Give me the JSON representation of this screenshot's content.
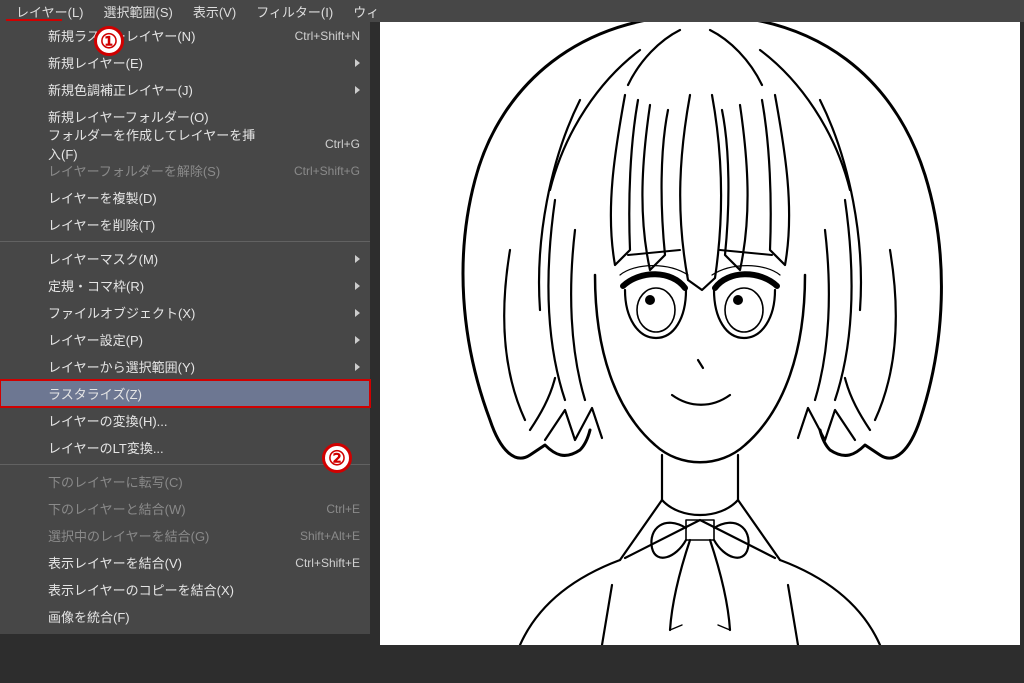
{
  "menubar": {
    "items": [
      {
        "label": "レイヤー(L)",
        "active": true
      },
      {
        "label": "選択範囲(S)"
      },
      {
        "label": "表示(V)"
      },
      {
        "label": "フィルター(I)"
      },
      {
        "label": "ウィ"
      }
    ]
  },
  "dropdown": {
    "items": [
      {
        "label": "新規ラスターレイヤー(N)",
        "shortcut": "Ctrl+Shift+N"
      },
      {
        "label": "新規レイヤー(E)",
        "submenu": true
      },
      {
        "label": "新規色調補正レイヤー(J)",
        "submenu": true
      },
      {
        "label": "新規レイヤーフォルダー(O)"
      },
      {
        "label": "フォルダーを作成してレイヤーを挿入(F)",
        "shortcut": "Ctrl+G"
      },
      {
        "label": "レイヤーフォルダーを解除(S)",
        "shortcut": "Ctrl+Shift+G",
        "disabled": true
      },
      {
        "label": "レイヤーを複製(D)"
      },
      {
        "label": "レイヤーを削除(T)"
      },
      {
        "sep": true
      },
      {
        "label": "レイヤーマスク(M)",
        "submenu": true
      },
      {
        "label": "定規・コマ枠(R)",
        "submenu": true
      },
      {
        "label": "ファイルオブジェクト(X)",
        "submenu": true
      },
      {
        "label": "レイヤー設定(P)",
        "submenu": true
      },
      {
        "label": "レイヤーから選択範囲(Y)",
        "submenu": true
      },
      {
        "label": "ラスタライズ(Z)",
        "highlight": true
      },
      {
        "label": "レイヤーの変換(H)..."
      },
      {
        "label": "レイヤーのLT変換..."
      },
      {
        "sep": true
      },
      {
        "label": "下のレイヤーに転写(C)",
        "disabled": true
      },
      {
        "label": "下のレイヤーと結合(W)",
        "shortcut": "Ctrl+E",
        "disabled": true
      },
      {
        "label": "選択中のレイヤーを結合(G)",
        "shortcut": "Shift+Alt+E",
        "disabled": true
      },
      {
        "label": "表示レイヤーを結合(V)",
        "shortcut": "Ctrl+Shift+E"
      },
      {
        "label": "表示レイヤーのコピーを結合(X)"
      },
      {
        "label": "画像を統合(F)"
      }
    ]
  },
  "annotations": {
    "one": "①",
    "two": "②"
  }
}
